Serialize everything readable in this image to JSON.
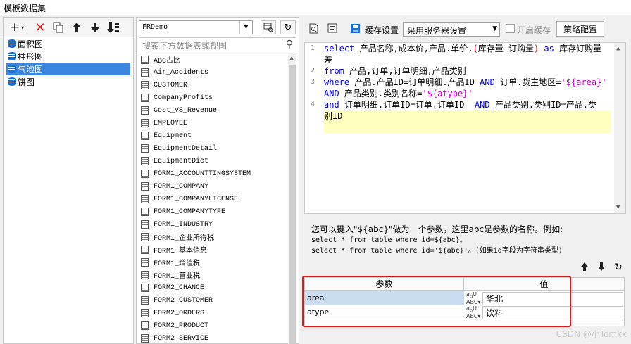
{
  "window": {
    "title": "模板数据集"
  },
  "left_panel": {
    "toolbar": {
      "add_icon": "plus-dropdown-icon",
      "delete_icon": "red-x-icon",
      "copy_icon": "copy-icon",
      "up_icon": "arrow-up-icon",
      "down_icon": "arrow-down-icon",
      "sort_icon": "sort-down-icon"
    },
    "items": [
      {
        "label": "面积图",
        "selected": false
      },
      {
        "label": "柱形图",
        "selected": false
      },
      {
        "label": "气泡图",
        "selected": true
      },
      {
        "label": "饼图",
        "selected": false
      }
    ]
  },
  "middle_panel": {
    "database": "FRDemo",
    "search_placeholder": "搜索下方数据表或视图",
    "tables": [
      "ABC占比",
      "Air_Accidents",
      "CUSTOMER",
      "CompanyProfits",
      "Cost_VS_Revenue",
      "EMPLOYEE",
      "Equipment",
      "EquipmentDetail",
      "EquipmentDict",
      "FORM1_ACCOUNTTINGSYSTEM",
      "FORM1_COMPANY",
      "FORM1_COMPANYLICENSE",
      "FORM1_COMPANYTYPE",
      "FORM1_INDUSTRY",
      "FORM1_企业所得税",
      "FORM1_基本信息",
      "FORM1_增值税",
      "FORM1_营业税",
      "FORM2_CHANCE",
      "FORM2_CUSTOMER",
      "FORM2_ORDERS",
      "FORM2_PRODUCT",
      "FORM2_SERVICE"
    ]
  },
  "right_panel": {
    "toolbar": {
      "cache_label": "缓存设置",
      "cache_mode": "采用服务器设置",
      "enable_cache_label": "开启缓存",
      "enable_cache_checked": false,
      "strategy_button": "策略配置"
    },
    "sql_lines": [
      {
        "no": "1",
        "text": "select 产品名称,成本价,产品.单价,(库存量-订购量) as 库存订购量"
      },
      {
        "no": "",
        "text": "差"
      },
      {
        "no": "2",
        "text": "from 产品,订单,订单明细,产品类别"
      },
      {
        "no": "3",
        "text": "where 产品.产品ID=订单明细.产品ID AND 订单.货主地区='${area}'"
      },
      {
        "no": "",
        "text": "AND 产品类别.类别名称='${atype}'"
      },
      {
        "no": "4",
        "text": "and 订单明细.订单ID=订单.订单ID  AND 产品类别.类别ID=产品.类"
      },
      {
        "no": "",
        "text": "别ID"
      }
    ],
    "hint": {
      "line1": "您可以键入\"${abc}\"做为一个参数，这里abc是参数的名称。例如:",
      "line2": "select * from table where id=${abc}。",
      "line3": "select * from table where id='${abc}'。(如果id字段为字符串类型)"
    },
    "params": {
      "header_name": "参数",
      "header_value": "值",
      "rows": [
        {
          "name": "area",
          "value": "华北"
        },
        {
          "name": "atype",
          "value": "饮料"
        }
      ]
    }
  },
  "watermark": "CSDN @小Tomkk"
}
